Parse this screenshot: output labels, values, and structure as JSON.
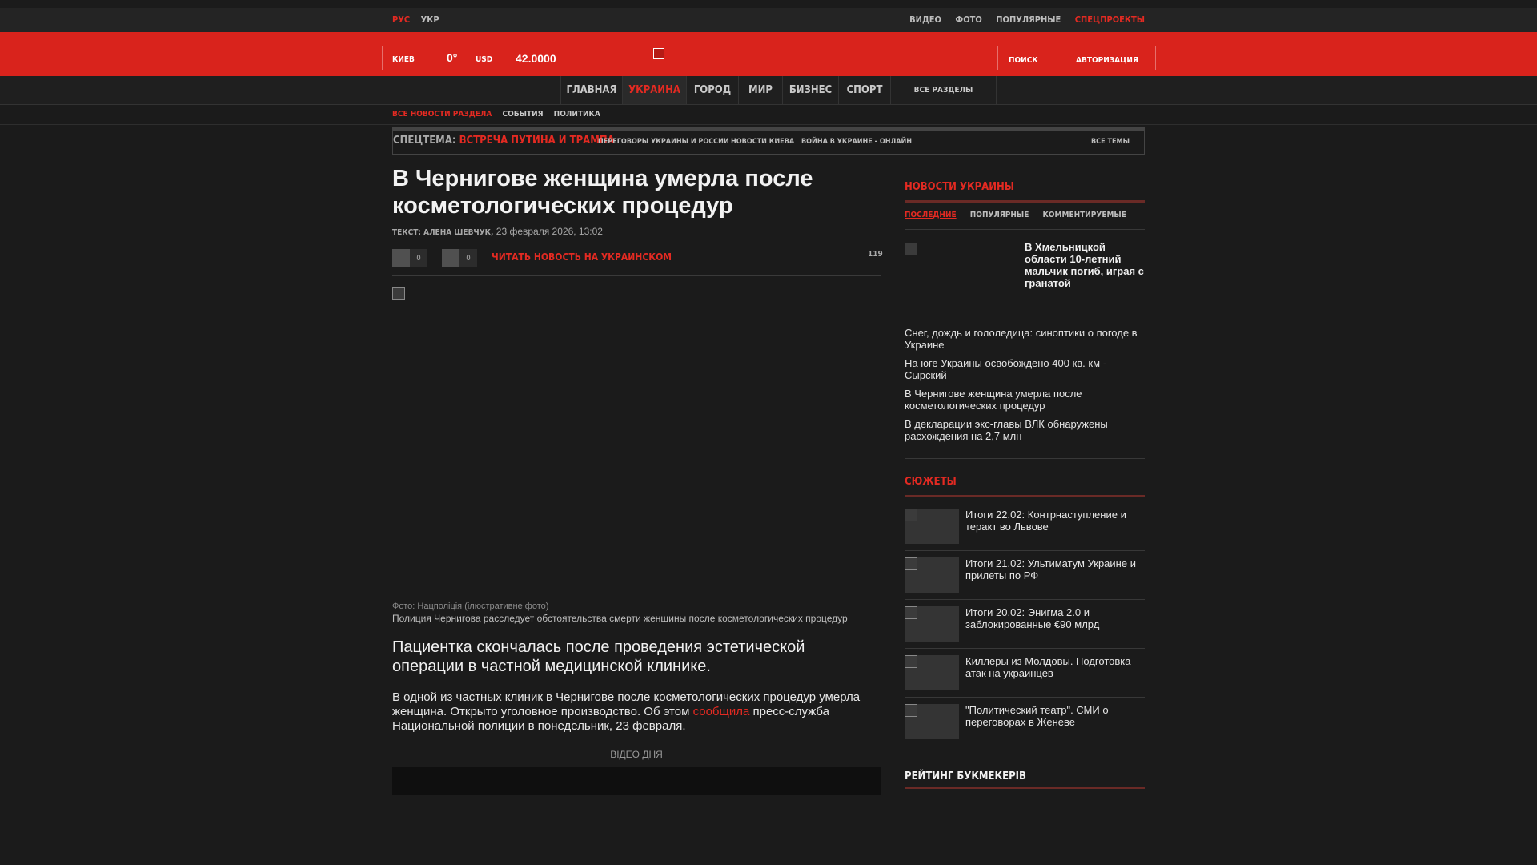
{
  "topbar": {
    "langs": [
      "РУС",
      "УКР"
    ],
    "links": [
      "ВИДЕО",
      "ФОТО",
      "ПОПУЛЯРНЫЕ",
      "СПЕЦПРОЕКТЫ"
    ]
  },
  "header": {
    "city": "КИЕВ",
    "temp": "0°",
    "currency": "USD",
    "rate": "42.0000",
    "search": "ПОИСК",
    "login": "АВТОРИЗАЦИЯ"
  },
  "nav": {
    "items": [
      "ГЛАВНАЯ",
      "УКРАИНА",
      "ГОРОД",
      "МИР",
      "БИЗНЕС",
      "СПОРТ"
    ],
    "all": "ВСЕ РАЗДЕЛЫ"
  },
  "subnav": [
    "ВСЕ НОВОСТИ РАЗДЕЛА",
    "СОБЫТИЯ",
    "ПОЛИТИКА"
  ],
  "themes": {
    "label": "СПЕЦТЕМА:",
    "main": "ВСТРЕЧА ПУТИНА И ТРАМПА",
    "items": [
      "ПЕРЕГОВОРЫ УКРАИНЫ И РОССИИ",
      "НОВОСТИ КИЕВА",
      "ВОЙНА В УКРАИНЕ - ОНЛАЙН"
    ],
    "all": "ВСЕ ТЕМЫ"
  },
  "article": {
    "title": "В Чернигове женщина умерла после косметологических процедур",
    "author": "ТЕКСТ: АЛЕНА ШЕВЧУК,",
    "date": "23 февраля 2026, 13:02",
    "share_counts": [
      "0",
      "0"
    ],
    "ukr_link": "ЧИТАТЬ НОВОСТЬ НА УКРАИНСКОМ",
    "views": "119",
    "photo_credit": "Фото: Нацполіція (ілюстративне фото)",
    "photo_caption": "Полиция Чернигова расследует обстоятельства смерти женщины после косметологических процедур",
    "lead": "Пациентка скончалась после проведения эстетической операции в частной медицинской клинике.",
    "body_before": "В одной из частных клиник в Чернигове после косметологических процедур умерла женщина. Открыто уголовное производство. Об этом ",
    "body_link": "сообщила",
    "body_after": " пресс-служба Национальной полиции в понедельник, 23 февраля.",
    "video_label": "ВІДЕО ДНЯ"
  },
  "sidebar": {
    "news_heading": "НОВОСТИ УКРАИНЫ",
    "tabs": [
      "ПОСЛЕДНИЕ",
      "ПОПУЛЯРНЫЕ",
      "КОММЕНТИРУЕМЫЕ"
    ],
    "featured": "В Хмельницкой области 10-летний мальчик погиб, играя с гранатой",
    "news": [
      "Снег, дождь и гололедица: синоптики о погоде в Украине",
      "На юге Украины освобождено 400 кв. км - Сырский",
      "В Чернигове женщина умерла после косметологических процедур",
      "В декларации экс-главы ВЛК обнаружены расхождения на 2,7 млн"
    ],
    "stories_heading": "СЮЖЕТЫ",
    "stories": [
      "Итоги 22.02: Контрнаступление и теракт во Львове",
      "Итоги 21.02: Ультиматум Украине и прилеты по РФ",
      "Итоги 20.02: Энигма 2.0 и заблокированные €90 млрд",
      "Киллеры из Молдовы. Подготовка атак на украинцев",
      "\"Политический театр\". СМИ о переговорах в Женеве"
    ],
    "bookmakers_heading": "РЕЙТИНГ БУКМЕКЕРІВ"
  }
}
